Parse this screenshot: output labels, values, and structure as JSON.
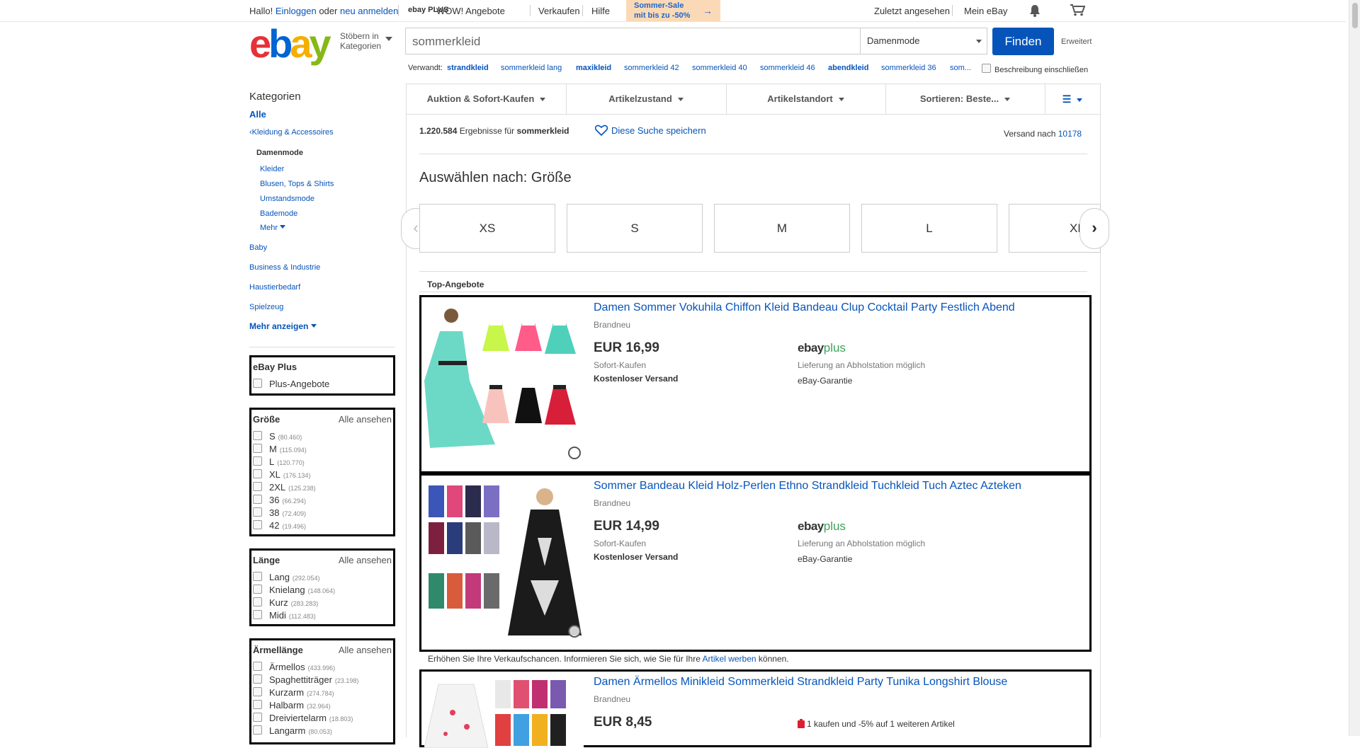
{
  "topbar": {
    "greeting": "Hallo!",
    "login": "Einloggen",
    "or": "oder",
    "register": "neu anmelden",
    "ebay_plus": "ebay PLUS",
    "wow": "WOW! Angebote",
    "sell": "Verkaufen",
    "help": "Hilfe",
    "promo_line1": "Sommer-Sale",
    "promo_line2": "mit bis zu -50%",
    "recently_viewed": "Zuletzt angesehen",
    "my_ebay": "Mein eBay"
  },
  "header": {
    "logo": {
      "e": "e",
      "b": "b",
      "a": "a",
      "y": "y"
    },
    "browse_line1": "Stöbern in",
    "browse_line2": "Kategorien",
    "search_value": "sommerkleid",
    "category_selected": "Damenmode",
    "find_label": "Finden",
    "advanced_label": "Erweitert"
  },
  "related": {
    "label": "Verwandt:",
    "items": [
      "strandkleid",
      "sommerkleid lang",
      "maxikleid",
      "sommerkleid 42",
      "sommerkleid 40",
      "sommerkleid 46",
      "abendkleid",
      "sommerkleid 36",
      "som..."
    ],
    "desc_checkbox": "Beschreibung einschließen"
  },
  "categories": {
    "title": "Kategorien",
    "all": "Alle",
    "parent": "Kleidung & Accessoires",
    "current": "Damenmode",
    "sub": [
      "Kleider",
      "Blusen, Tops & Shirts",
      "Umstandsmode",
      "Bademode"
    ],
    "more_sub": "Mehr",
    "others": [
      "Baby",
      "Business & Industrie",
      "Haustierbedarf",
      "Spielzeug"
    ],
    "show_more": "Mehr anzeigen"
  },
  "ebay_plus_filter": {
    "title": "eBay Plus",
    "option": "Plus-Angebote"
  },
  "size_filter": {
    "title": "Größe",
    "see_all": "Alle ansehen",
    "options": [
      {
        "label": "S",
        "count": "(80.460)"
      },
      {
        "label": "M",
        "count": "(115.094)"
      },
      {
        "label": "L",
        "count": "(120.770)"
      },
      {
        "label": "XL",
        "count": "(176.134)"
      },
      {
        "label": "2XL",
        "count": "(125.238)"
      },
      {
        "label": "36",
        "count": "(66.294)"
      },
      {
        "label": "38",
        "count": "(72.409)"
      },
      {
        "label": "42",
        "count": "(19.496)"
      }
    ]
  },
  "length_filter": {
    "title": "Länge",
    "see_all": "Alle ansehen",
    "options": [
      {
        "label": "Lang",
        "count": "(292.054)"
      },
      {
        "label": "Knielang",
        "count": "(148.064)"
      },
      {
        "label": "Kurz",
        "count": "(283.283)"
      },
      {
        "label": "Midi",
        "count": "(112.483)"
      }
    ]
  },
  "sleeve_filter": {
    "title": "Ärmellänge",
    "see_all": "Alle ansehen",
    "options": [
      {
        "label": "Ärmellos",
        "count": "(433.996)"
      },
      {
        "label": "Spaghettiträger",
        "count": "(23.198)"
      },
      {
        "label": "Kurzarm",
        "count": "(274.784)"
      },
      {
        "label": "Halbarm",
        "count": "(32.964)"
      },
      {
        "label": "Dreiviertelarm",
        "count": "(18.803)"
      },
      {
        "label": "Langarm",
        "count": "(80.053)"
      }
    ]
  },
  "filterbar": {
    "format": "Auktion & Sofort-Kaufen",
    "condition": "Artikelzustand",
    "location": "Artikelstandort",
    "sort": "Sortieren: Beste..."
  },
  "results": {
    "count": "1.220.584",
    "count_suffix": "Ergebnisse für",
    "query": "sommerkleid",
    "save_search": "Diese Suche speichern",
    "ship_to_label": "Versand nach",
    "zip": "10178",
    "size_heading": "Auswählen nach: Größe",
    "sizes": [
      "XS",
      "S",
      "M",
      "L",
      "XL"
    ],
    "top_offers": "Top-Angebote",
    "promo_text": "Erhöhen Sie Ihre Verkaufschancen. Informieren Sie sich, wie Sie für Ihre",
    "promo_link": "Artikel werben",
    "promo_end": "können."
  },
  "listings": [
    {
      "title": "Damen Sommer Vokuhila Chiffon Kleid Bandeau Clup Cocktail Party Festlich Abend",
      "condition": "Brandneu",
      "price": "EUR 16,99",
      "buy_type": "Sofort-Kaufen",
      "shipping": "Kostenloser Versand",
      "plus_ebay": "ebay",
      "plus_plus": "plus",
      "pickup": "Lieferung an Abholstation möglich",
      "guarantee": "eBay-Garantie"
    },
    {
      "title": "Sommer Bandeau Kleid Holz-Perlen Ethno Strandkleid Tuchkleid Tuch Aztec Azteken",
      "condition": "Brandneu",
      "price": "EUR 14,99",
      "buy_type": "Sofort-Kaufen",
      "shipping": "Kostenloser Versand",
      "plus_ebay": "ebay",
      "plus_plus": "plus",
      "pickup": "Lieferung an Abholstation möglich",
      "guarantee": "eBay-Garantie"
    },
    {
      "title": "Damen Ärmellos Minikleid Sommerkleid Strandkleid Party Tunika Longshirt Blouse",
      "condition": "Brandneu",
      "price": "EUR 8,45",
      "deal": "1 kaufen und -5% auf 1 weiteren Artikel"
    }
  ],
  "colors": {
    "link": "#0654ba",
    "button": "#0654ba",
    "promo_bg": "#fcd9b6",
    "plus_green": "#3fa35a"
  }
}
